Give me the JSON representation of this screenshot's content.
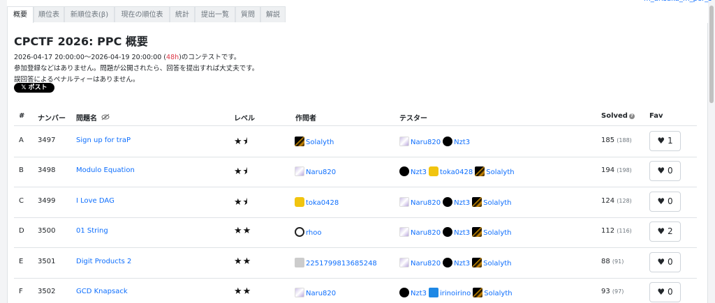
{
  "top_user": "m_arisaka_m_per_s",
  "tabs": [
    "概要",
    "順位表",
    "新順位表(β)",
    "現在の順位表",
    "統計",
    "提出一覧",
    "質問",
    "解説"
  ],
  "title": "CPCTF 2026: PPC 概要",
  "period_prefix": "2026-04-17 20:00:00～2026-04-19 20:00:00 (",
  "period_duration": "48h",
  "period_suffix": ")のコンテストです。",
  "info_line2": "参加登録などはありません。問題が公開されたら、回答を提出すれば大丈夫です。",
  "info_line3": "誤回答によるペナルティーはありません。",
  "post_button": "𝕏 ポスト",
  "headers": {
    "index": "#",
    "number": "ナンバー",
    "name": "問題名",
    "level": "レベル",
    "author": "作問者",
    "testers": "テスター",
    "solved": "Solved",
    "fav": "Fav"
  },
  "rows": [
    {
      "index": "A",
      "number": "3497",
      "name": "Sign up for traP",
      "level": "★⯨",
      "level_value": 1.5,
      "author": "Solalyth",
      "author_icon": "sol",
      "testers": [
        {
          "name": "Naru820",
          "icon": "naru"
        },
        {
          "name": "Nzt3",
          "icon": "nzt"
        }
      ],
      "solved": "185",
      "solved_total": "(188)",
      "fav": "1"
    },
    {
      "index": "B",
      "number": "3498",
      "name": "Modulo Equation",
      "level": "★⯨",
      "level_value": 1.5,
      "author": "Naru820",
      "author_icon": "naru",
      "testers": [
        {
          "name": "Nzt3",
          "icon": "nzt"
        },
        {
          "name": "toka0428",
          "icon": "toka"
        },
        {
          "name": "Solalyth",
          "icon": "sol"
        }
      ],
      "solved": "194",
      "solved_total": "(198)",
      "fav": "0"
    },
    {
      "index": "C",
      "number": "3499",
      "name": "I Love DAG",
      "level": "★⯨",
      "level_value": 1.5,
      "author": "toka0428",
      "author_icon": "toka",
      "testers": [
        {
          "name": "Naru820",
          "icon": "naru"
        },
        {
          "name": "Nzt3",
          "icon": "nzt"
        },
        {
          "name": "Solalyth",
          "icon": "sol"
        }
      ],
      "solved": "124",
      "solved_total": "(128)",
      "fav": "0"
    },
    {
      "index": "D",
      "number": "3500",
      "name": "01 String",
      "level": "★★",
      "level_value": 2,
      "author": "rhoo",
      "author_icon": "rhoo",
      "testers": [
        {
          "name": "Naru820",
          "icon": "naru"
        },
        {
          "name": "Nzt3",
          "icon": "nzt"
        },
        {
          "name": "Solalyth",
          "icon": "sol"
        }
      ],
      "solved": "112",
      "solved_total": "(116)",
      "fav": "2"
    },
    {
      "index": "E",
      "number": "3501",
      "name": "Digit Products 2",
      "level": "★★",
      "level_value": 2,
      "author": "2251799813685248",
      "author_icon": "num",
      "testers": [
        {
          "name": "Naru820",
          "icon": "naru"
        },
        {
          "name": "Nzt3",
          "icon": "nzt"
        },
        {
          "name": "Solalyth",
          "icon": "sol"
        }
      ],
      "solved": "88",
      "solved_total": "(91)",
      "fav": "0"
    },
    {
      "index": "F",
      "number": "3502",
      "name": "GCD Knapsack",
      "level": "★★",
      "level_value": 2,
      "author": "Naru820",
      "author_icon": "naru",
      "testers": [
        {
          "name": "Nzt3",
          "icon": "nzt"
        },
        {
          "name": "irinoirino",
          "icon": "iri"
        },
        {
          "name": "Solalyth",
          "icon": "sol"
        }
      ],
      "solved": "93",
      "solved_total": "(97)",
      "fav": "0"
    }
  ]
}
